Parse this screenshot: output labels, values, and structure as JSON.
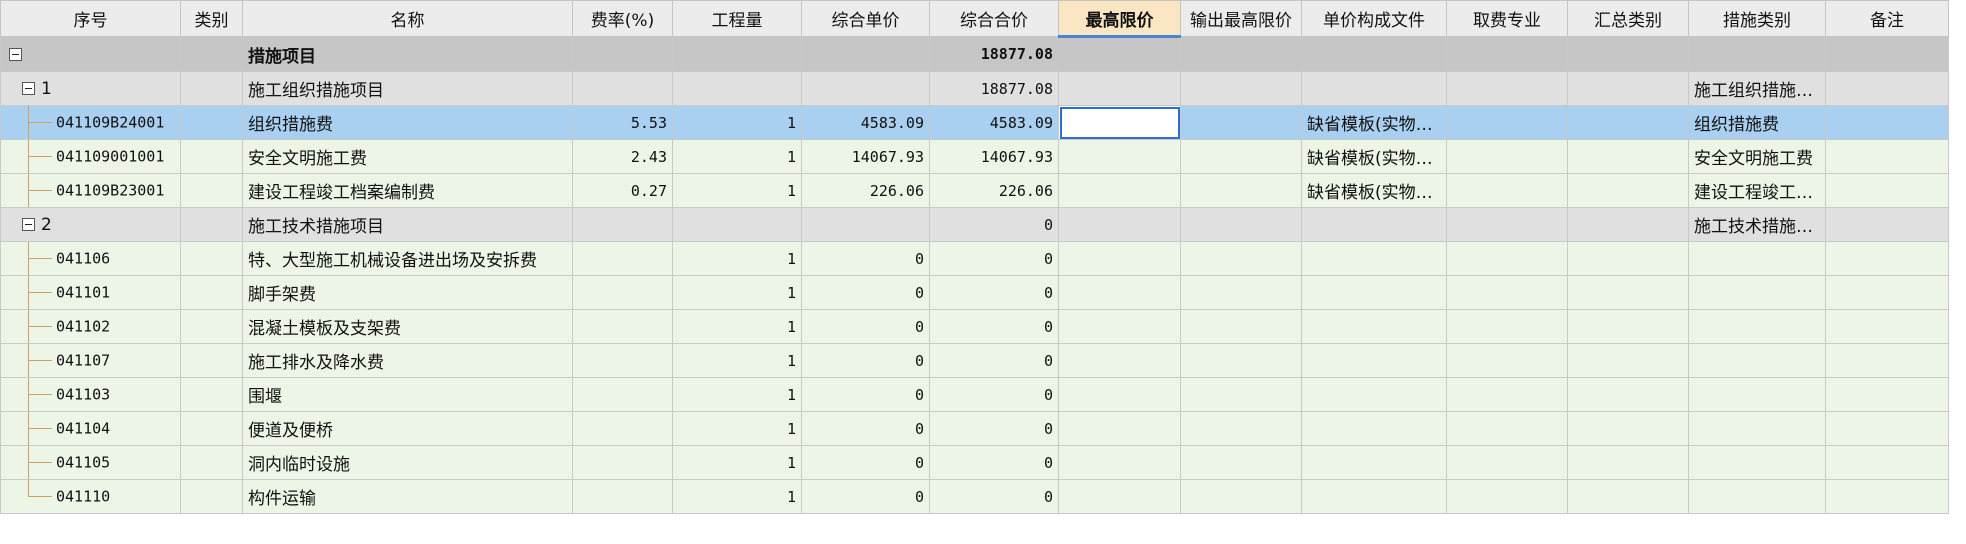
{
  "columns": [
    "序号",
    "类别",
    "名称",
    "费率(%)",
    "工程量",
    "综合单价",
    "综合合价",
    "最高限价",
    "输出最高限价",
    "单价构成文件",
    "取费专业",
    "汇总类别",
    "措施类别",
    "备注"
  ],
  "root": {
    "name": "措施项目",
    "total": "18877.08"
  },
  "groups": [
    {
      "seq": "1",
      "name": "施工组织措施项目",
      "total": "18877.08",
      "measure_type": "施工组织措施…",
      "rows": [
        {
          "code": "041109B24001",
          "name": "组织措施费",
          "rate": "5.53",
          "qty": "1",
          "unit_price": "4583.09",
          "total": "4583.09",
          "max_price": "",
          "price_file": "缺省模板(实物…",
          "measure_type": "组织措施费",
          "selected": true
        },
        {
          "code": "041109001001",
          "name": "安全文明施工费",
          "rate": "2.43",
          "qty": "1",
          "unit_price": "14067.93",
          "total": "14067.93",
          "max_price": "",
          "price_file": "缺省模板(实物…",
          "measure_type": "安全文明施工费"
        },
        {
          "code": "041109B23001",
          "name": "建设工程竣工档案编制费",
          "rate": "0.27",
          "qty": "1",
          "unit_price": "226.06",
          "total": "226.06",
          "max_price": "",
          "price_file": "缺省模板(实物…",
          "measure_type": "建设工程竣工…"
        }
      ]
    },
    {
      "seq": "2",
      "name": "施工技术措施项目",
      "total": "0",
      "measure_type": "施工技术措施…",
      "rows": [
        {
          "code": "041106",
          "name": "特、大型施工机械设备进出场及安拆费",
          "rate": "",
          "qty": "1",
          "unit_price": "0",
          "total": "0"
        },
        {
          "code": "041101",
          "name": "脚手架费",
          "rate": "",
          "qty": "1",
          "unit_price": "0",
          "total": "0"
        },
        {
          "code": "041102",
          "name": "混凝土模板及支架费",
          "rate": "",
          "qty": "1",
          "unit_price": "0",
          "total": "0"
        },
        {
          "code": "041107",
          "name": "施工排水及降水费",
          "rate": "",
          "qty": "1",
          "unit_price": "0",
          "total": "0"
        },
        {
          "code": "041103",
          "name": "围堰",
          "rate": "",
          "qty": "1",
          "unit_price": "0",
          "total": "0"
        },
        {
          "code": "041104",
          "name": "便道及便桥",
          "rate": "",
          "qty": "1",
          "unit_price": "0",
          "total": "0"
        },
        {
          "code": "041105",
          "name": "洞内临时设施",
          "rate": "",
          "qty": "1",
          "unit_price": "0",
          "total": "0"
        },
        {
          "code": "041110",
          "name": "构件运输",
          "rate": "",
          "qty": "1",
          "unit_price": "0",
          "total": "0"
        }
      ]
    }
  ]
}
